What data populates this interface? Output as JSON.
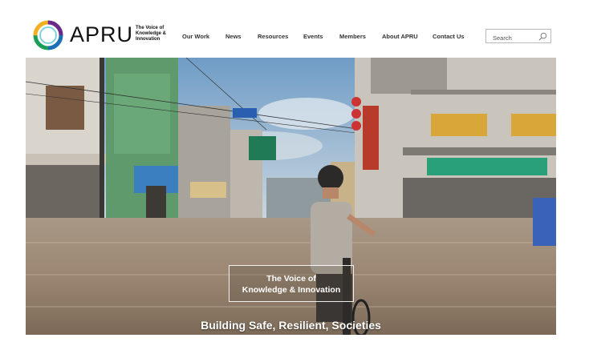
{
  "brand": {
    "name": "APRU",
    "tagline": [
      "The Voice of",
      "Knowledge &",
      "Innovation"
    ],
    "colors": [
      "#1b9e5a",
      "#f2b01e",
      "#1a6fb5",
      "#6a2a8a"
    ]
  },
  "nav": {
    "items": [
      {
        "label": "Our Work"
      },
      {
        "label": "News"
      },
      {
        "label": "Resources"
      },
      {
        "label": "Events"
      },
      {
        "label": "Members"
      },
      {
        "label": "About APRU"
      },
      {
        "label": "Contact Us"
      }
    ]
  },
  "search": {
    "placeholder": "Search",
    "icon": "magnifier-icon"
  },
  "hero": {
    "box_lines": [
      "The Voice of",
      "Knowledge & Innovation"
    ],
    "caption": "Building Safe, Resilient, Societies"
  }
}
